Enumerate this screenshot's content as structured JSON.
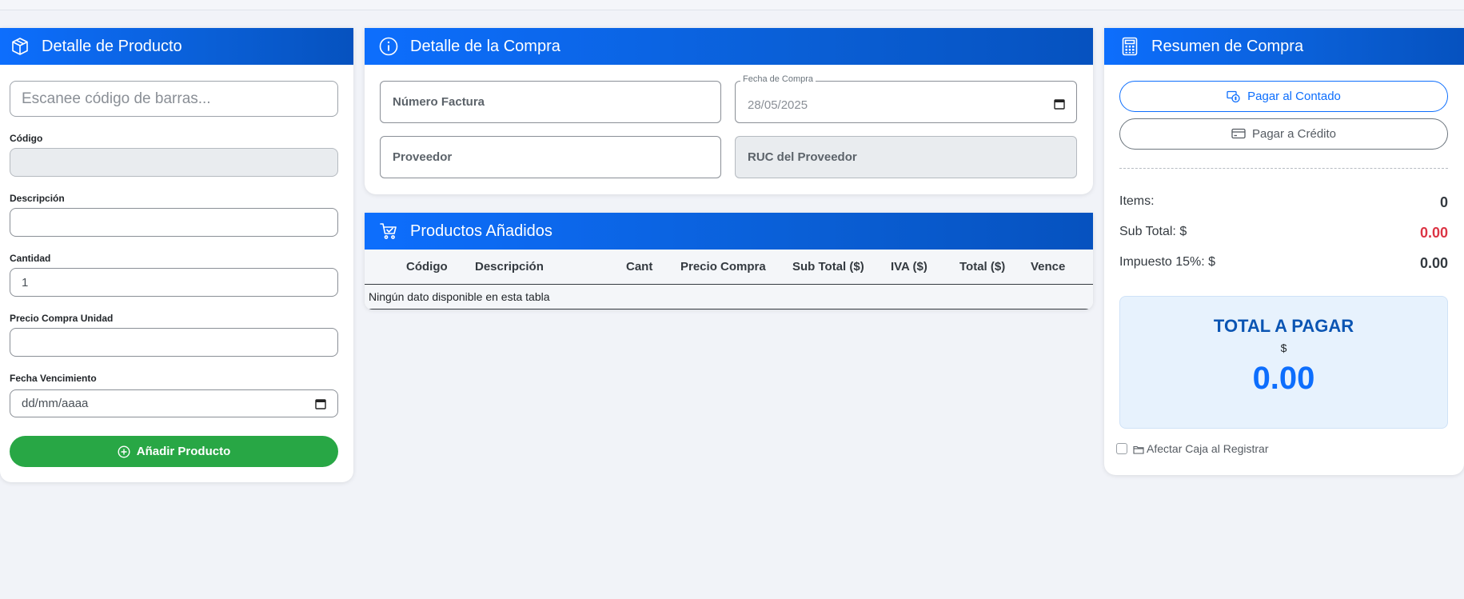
{
  "product_panel": {
    "title": "Detalle de Producto",
    "scan_placeholder": "Escanee código de barras...",
    "code_label": "Código",
    "code_value": "",
    "description_label": "Descripción",
    "description_value": "",
    "quantity_label": "Cantidad",
    "quantity_value": "1",
    "unit_price_label": "Precio Compra Unidad",
    "unit_price_value": "",
    "expiry_label": "Fecha Vencimiento",
    "expiry_placeholder": "dd/mm/aaaa",
    "add_button": "Añadir Producto"
  },
  "purchase_panel": {
    "title": "Detalle de la Compra",
    "invoice_label": "Número Factura",
    "date_label": "Fecha de Compra",
    "date_value": "28/05/2025",
    "supplier_label": "Proveedor",
    "ruc_label": "RUC del Proveedor"
  },
  "products_panel": {
    "title": "Productos Añadidos",
    "columns": [
      "Código",
      "Descripción",
      "Cant",
      "Precio Compra",
      "Sub Total ($)",
      "IVA ($)",
      "Total ($)",
      "Vence"
    ],
    "empty_message": "Ningún dato disponible en esta tabla"
  },
  "summary_panel": {
    "title": "Resumen de Compra",
    "pay_cash": "Pagar al Contado",
    "pay_credit": "Pagar a Crédito",
    "items_label": "Items:",
    "items_value": "0",
    "subtotal_label": "Sub Total: $",
    "subtotal_value": "0.00",
    "tax_label": "Impuesto 15%: $",
    "tax_value": "0.00",
    "total_title": "TOTAL A PAGAR",
    "total_currency": "$",
    "total_value": "0.00",
    "affect_cash_label": "Afectar Caja al Registrar",
    "affect_cash_checked": false
  },
  "colors": {
    "header_blue": "#0d6efd",
    "add_green": "#28a745",
    "subtotal_red": "#dc3545",
    "total_blue": "#0d6efd"
  },
  "icons": {
    "product_header": "box-icon",
    "purchase_header": "info-icon",
    "products_header": "cart-icon",
    "summary_header": "calculator-icon",
    "add_button": "plus-circle-icon",
    "pay_cash": "cash-icon",
    "pay_credit": "credit-card-icon",
    "affect_cash": "folder-icon"
  }
}
